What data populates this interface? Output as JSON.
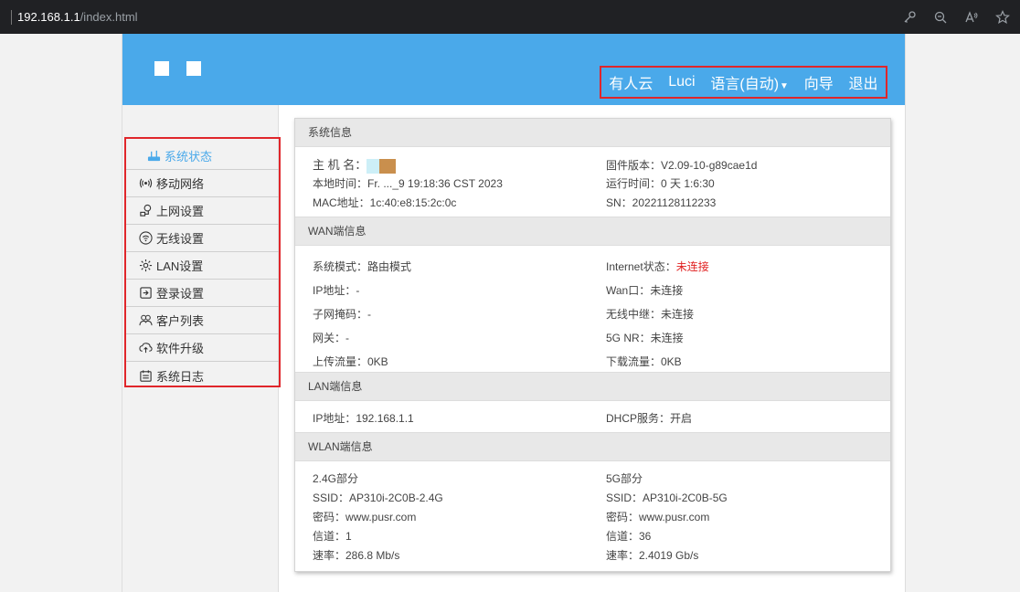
{
  "browser": {
    "url_host": "192.168.1.1",
    "url_path": "/index.html",
    "tools": [
      "key-icon",
      "zoom-out-icon",
      "read-aloud-icon",
      "favorite-icon"
    ]
  },
  "header": {
    "nav": {
      "youren": "有人云",
      "luci": "Luci",
      "language": "语言(自动)",
      "wizard": "向导",
      "logout": "退出"
    }
  },
  "sidebar": {
    "items": [
      {
        "label": "系统状态",
        "icon": "router-icon",
        "active": true
      },
      {
        "label": "移动网络",
        "icon": "signal-icon"
      },
      {
        "label": "上网设置",
        "icon": "network-icon"
      },
      {
        "label": "无线设置",
        "icon": "wifi-icon"
      },
      {
        "label": "LAN设置",
        "icon": "lan-gear-icon"
      },
      {
        "label": "登录设置",
        "icon": "login-icon"
      },
      {
        "label": "客户列表",
        "icon": "users-icon"
      },
      {
        "label": "软件升级",
        "icon": "upgrade-icon"
      },
      {
        "label": "系统日志",
        "icon": "log-icon"
      }
    ]
  },
  "system_info": {
    "title": "系统信息",
    "hostname_label": "主 机 名：",
    "local_time": "本地时间：Fr. ..._9 19:18:36 CST 2023",
    "mac": "MAC地址：1c:40:e8:15:2c:0c",
    "firmware": "固件版本：V2.09-10-g89cae1d",
    "uptime": "运行时间：0 天 1:6:30",
    "sn": "SN：20221128112233"
  },
  "wan_info": {
    "title": "WAN端信息",
    "mode": "系统模式：路由模式",
    "ip": "IP地址：-",
    "mask": "子网掩码：-",
    "gateway": "网关：-",
    "upload": "上传流量：0KB",
    "internet_label": "Internet状态：",
    "internet_value": "未连接",
    "wan_port": "Wan口：未连接",
    "wireless_relay": "无线中继：未连接",
    "nr5g": "5G NR：未连接",
    "download": "下载流量：0KB"
  },
  "lan_info": {
    "title": "LAN端信息",
    "ip": "IP地址：192.168.1.1",
    "dhcp": "DHCP服务：开启"
  },
  "wlan_info": {
    "title": "WLAN端信息",
    "g24": {
      "title": "2.4G部分",
      "ssid": "SSID：AP310i-2C0B-2.4G",
      "password": "密码：www.pusr.com",
      "channel": "信道：1",
      "rate": "速率：286.8 Mb/s"
    },
    "g5": {
      "title": "5G部分",
      "ssid": "SSID：AP310i-2C0B-5G",
      "password": "密码：www.pusr.com",
      "channel": "信道：36",
      "rate": "速率：2.4019 Gb/s"
    }
  },
  "colors": {
    "header_blue": "#4aa9ea",
    "highlight_red": "#e0262b",
    "status_red": "#e02020"
  }
}
